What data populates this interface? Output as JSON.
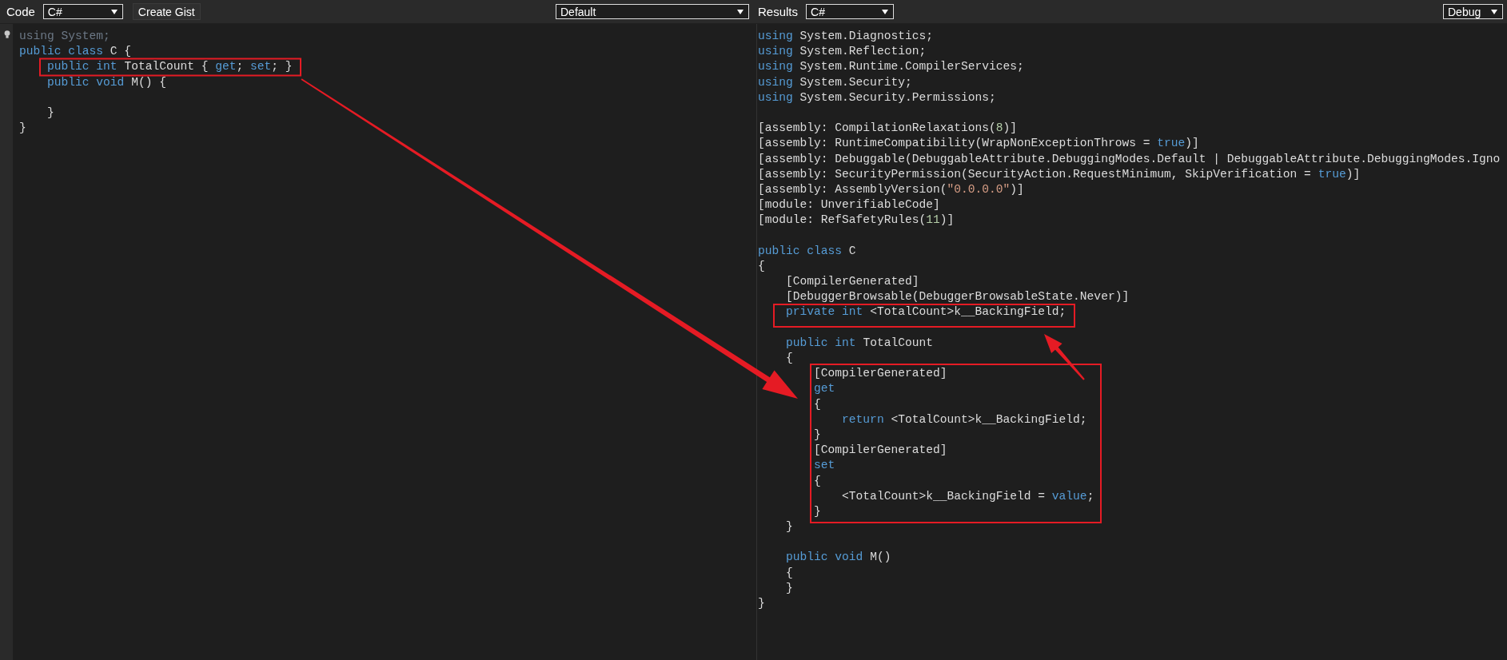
{
  "code_toolbar": {
    "label": "Code",
    "language_select": {
      "value": "C#"
    },
    "gist_button": "Create Gist",
    "mode_select": {
      "value": "Default"
    }
  },
  "code_editor": {
    "lines": [
      {
        "kind": "code",
        "tokens": [
          {
            "kind": "dim",
            "text": "using System;"
          }
        ]
      },
      {
        "kind": "code",
        "tokens": [
          {
            "kind": "kw",
            "text": "public class "
          },
          {
            "kind": "plain",
            "text": "C {"
          }
        ]
      },
      {
        "kind": "code",
        "tokens": [
          {
            "kind": "kw",
            "text": "    public int "
          },
          {
            "kind": "plain",
            "text": "TotalCount { "
          },
          {
            "kind": "kw",
            "text": "get"
          },
          {
            "kind": "plain",
            "text": "; "
          },
          {
            "kind": "kw",
            "text": "set"
          },
          {
            "kind": "plain",
            "text": "; }"
          }
        ]
      },
      {
        "kind": "code",
        "tokens": [
          {
            "kind": "kw",
            "text": "    public void "
          },
          {
            "kind": "plain",
            "text": "M() {"
          }
        ]
      },
      {
        "kind": "blank"
      },
      {
        "kind": "code",
        "tokens": [
          {
            "kind": "plain",
            "text": "    }"
          }
        ]
      },
      {
        "kind": "code",
        "tokens": [
          {
            "kind": "plain",
            "text": "}"
          }
        ]
      }
    ]
  },
  "results_toolbar": {
    "label": "Results",
    "language_select": {
      "value": "C#"
    },
    "build_select": {
      "value": "Debug"
    }
  },
  "results_view": {
    "lines": [
      {
        "kind": "code",
        "tokens": [
          {
            "kind": "kw",
            "text": "using "
          },
          {
            "kind": "plain",
            "text": "System.Diagnostics;"
          }
        ]
      },
      {
        "kind": "code",
        "tokens": [
          {
            "kind": "kw",
            "text": "using "
          },
          {
            "kind": "plain",
            "text": "System.Reflection;"
          }
        ]
      },
      {
        "kind": "code",
        "tokens": [
          {
            "kind": "kw",
            "text": "using "
          },
          {
            "kind": "plain",
            "text": "System.Runtime.CompilerServices;"
          }
        ]
      },
      {
        "kind": "code",
        "tokens": [
          {
            "kind": "kw",
            "text": "using "
          },
          {
            "kind": "plain",
            "text": "System.Security;"
          }
        ]
      },
      {
        "kind": "code",
        "tokens": [
          {
            "kind": "kw",
            "text": "using "
          },
          {
            "kind": "plain",
            "text": "System.Security.Permissions;"
          }
        ]
      },
      {
        "kind": "blank"
      },
      {
        "kind": "code",
        "tokens": [
          {
            "kind": "plain",
            "text": "[assembly: CompilationRelaxations("
          },
          {
            "kind": "num",
            "text": "8"
          },
          {
            "kind": "plain",
            "text": ")]"
          }
        ]
      },
      {
        "kind": "code",
        "tokens": [
          {
            "kind": "plain",
            "text": "[assembly: RuntimeCompatibility(WrapNonExceptionThrows = "
          },
          {
            "kind": "kw",
            "text": "true"
          },
          {
            "kind": "plain",
            "text": ")]"
          }
        ]
      },
      {
        "kind": "code",
        "tokens": [
          {
            "kind": "plain",
            "text": "[assembly: Debuggable(DebuggableAttribute.DebuggingModes.Default | DebuggableAttribute.DebuggingModes.Igno"
          }
        ]
      },
      {
        "kind": "code",
        "tokens": [
          {
            "kind": "plain",
            "text": "[assembly: SecurityPermission(SecurityAction.RequestMinimum, SkipVerification = "
          },
          {
            "kind": "kw",
            "text": "true"
          },
          {
            "kind": "plain",
            "text": ")]"
          }
        ]
      },
      {
        "kind": "code",
        "tokens": [
          {
            "kind": "plain",
            "text": "[assembly: AssemblyVersion("
          },
          {
            "kind": "str",
            "text": "\"0.0.0.0\""
          },
          {
            "kind": "plain",
            "text": ")]"
          }
        ]
      },
      {
        "kind": "code",
        "tokens": [
          {
            "kind": "plain",
            "text": "[module: UnverifiableCode]"
          }
        ]
      },
      {
        "kind": "code",
        "tokens": [
          {
            "kind": "plain",
            "text": "[module: RefSafetyRules("
          },
          {
            "kind": "num",
            "text": "11"
          },
          {
            "kind": "plain",
            "text": ")]"
          }
        ]
      },
      {
        "kind": "blank"
      },
      {
        "kind": "code",
        "tokens": [
          {
            "kind": "kw",
            "text": "public class "
          },
          {
            "kind": "plain",
            "text": "C"
          }
        ]
      },
      {
        "kind": "code",
        "tokens": [
          {
            "kind": "plain",
            "text": "{"
          }
        ]
      },
      {
        "kind": "code",
        "tokens": [
          {
            "kind": "plain",
            "text": "    [CompilerGenerated]"
          }
        ]
      },
      {
        "kind": "code",
        "tokens": [
          {
            "kind": "plain",
            "text": "    [DebuggerBrowsable(DebuggerBrowsableState.Never)]"
          }
        ]
      },
      {
        "kind": "code",
        "tokens": [
          {
            "kind": "kw",
            "text": "    private int "
          },
          {
            "kind": "plain",
            "text": "<TotalCount>k__BackingField;"
          }
        ]
      },
      {
        "kind": "blank"
      },
      {
        "kind": "code",
        "tokens": [
          {
            "kind": "kw",
            "text": "    public int "
          },
          {
            "kind": "plain",
            "text": "TotalCount"
          }
        ]
      },
      {
        "kind": "code",
        "tokens": [
          {
            "kind": "plain",
            "text": "    {"
          }
        ]
      },
      {
        "kind": "code",
        "tokens": [
          {
            "kind": "plain",
            "text": "        [CompilerGenerated]"
          }
        ]
      },
      {
        "kind": "code",
        "tokens": [
          {
            "kind": "kw",
            "text": "        get"
          }
        ]
      },
      {
        "kind": "code",
        "tokens": [
          {
            "kind": "plain",
            "text": "        {"
          }
        ]
      },
      {
        "kind": "code",
        "tokens": [
          {
            "kind": "kw",
            "text": "            return "
          },
          {
            "kind": "plain",
            "text": "<TotalCount>k__BackingField;"
          }
        ]
      },
      {
        "kind": "code",
        "tokens": [
          {
            "kind": "plain",
            "text": "        }"
          }
        ]
      },
      {
        "kind": "code",
        "tokens": [
          {
            "kind": "plain",
            "text": "        [CompilerGenerated]"
          }
        ]
      },
      {
        "kind": "code",
        "tokens": [
          {
            "kind": "kw",
            "text": "        set"
          }
        ]
      },
      {
        "kind": "code",
        "tokens": [
          {
            "kind": "plain",
            "text": "        {"
          }
        ]
      },
      {
        "kind": "code",
        "tokens": [
          {
            "kind": "plain",
            "text": "            <TotalCount>k__BackingField = "
          },
          {
            "kind": "kw",
            "text": "value"
          },
          {
            "kind": "plain",
            "text": ";"
          }
        ]
      },
      {
        "kind": "code",
        "tokens": [
          {
            "kind": "plain",
            "text": "        }"
          }
        ]
      },
      {
        "kind": "code",
        "tokens": [
          {
            "kind": "plain",
            "text": "    }"
          }
        ]
      },
      {
        "kind": "blank"
      },
      {
        "kind": "code",
        "tokens": [
          {
            "kind": "kw",
            "text": "    public void "
          },
          {
            "kind": "plain",
            "text": "M()"
          }
        ]
      },
      {
        "kind": "code",
        "tokens": [
          {
            "kind": "plain",
            "text": "    {"
          }
        ]
      },
      {
        "kind": "code",
        "tokens": [
          {
            "kind": "plain",
            "text": "    }"
          }
        ]
      },
      {
        "kind": "code",
        "tokens": [
          {
            "kind": "plain",
            "text": "}"
          }
        ]
      }
    ]
  }
}
